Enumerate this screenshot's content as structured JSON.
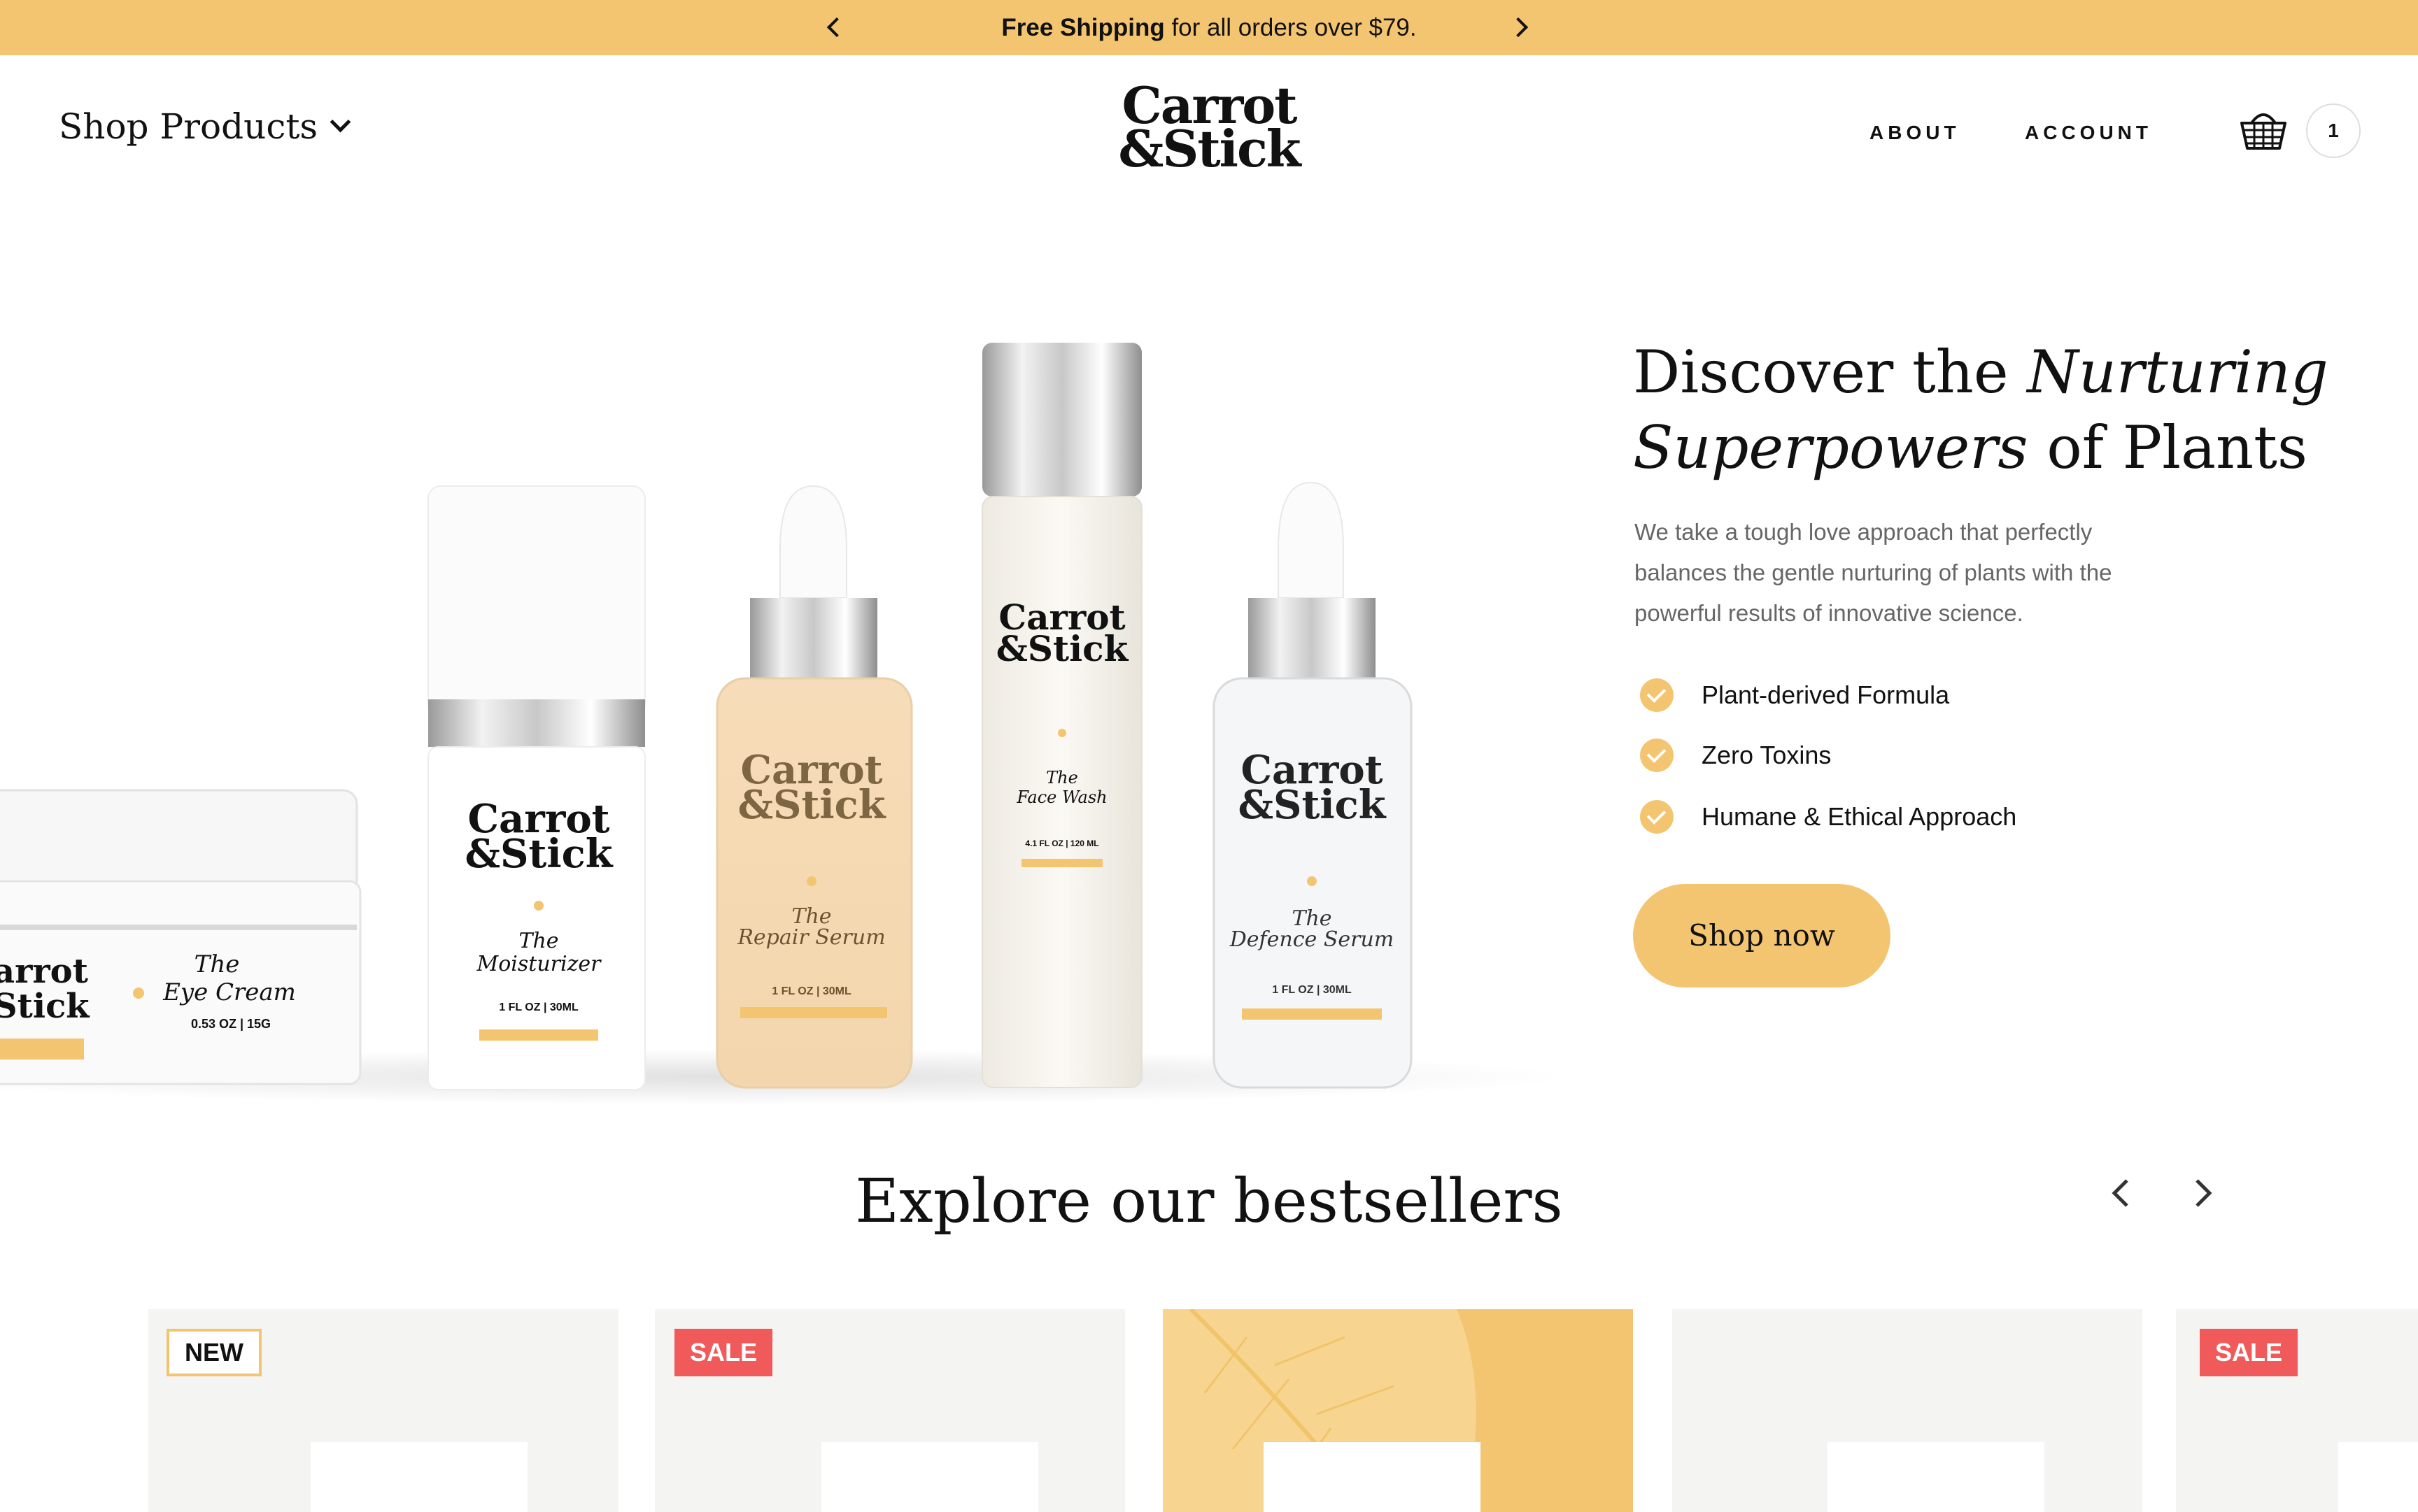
{
  "announcement": {
    "bold": "Free Shipping",
    "rest": " for all orders over $79."
  },
  "header": {
    "shop_products": "Shop Products",
    "logo_line1": "Carrot",
    "logo_line2": "&Stick",
    "about": "ABOUT",
    "account": "ACCOUNT",
    "cart_count": "1"
  },
  "hero": {
    "title_part1": "Discover the ",
    "title_italic1": "Nurturing",
    "title_italic2": "Superpowers",
    "title_part2": " of Plants",
    "description": "We take a tough love approach that perfectly balances the gentle nurturing of plants with the powerful results of innovative science.",
    "features": [
      "Plant-derived Formula",
      "Zero Toxins",
      "Humane & Ethical Approach"
    ],
    "cta": "Shop now",
    "products": [
      {
        "name_line1": "The",
        "name_line2": "Eye Cream",
        "size": "0.53 OZ | 15G"
      },
      {
        "name_line1": "The",
        "name_line2": "Moisturizer",
        "size": "1 FL OZ | 30ML"
      },
      {
        "name_line1": "The",
        "name_line2": "Repair Serum",
        "size": "1 FL OZ | 30ML"
      },
      {
        "name_line1": "The",
        "name_line2": "Face Wash",
        "size": "4.1 FL OZ | 120 ML"
      },
      {
        "name_line1": "The",
        "name_line2": "Defence Serum",
        "size": "1 FL OZ | 30ML"
      }
    ]
  },
  "bestsellers": {
    "title": "Explore our bestsellers",
    "badges": [
      "NEW",
      "SALE",
      "SALE"
    ]
  },
  "colors": {
    "accent": "#f4c571",
    "sale": "#f15a5a",
    "card_bg": "#f4f4f3"
  }
}
